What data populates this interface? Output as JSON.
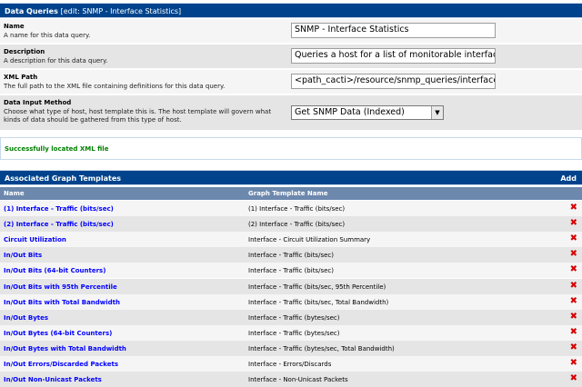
{
  "header": {
    "title": "Data Queries",
    "subtitle": "[edit: SNMP - Interface Statistics]"
  },
  "fields": {
    "name": {
      "label": "Name",
      "description": "A name for this data query.",
      "value": "SNMP - Interface Statistics"
    },
    "description": {
      "label": "Description",
      "description": "A description for this data query.",
      "value": "Queries a host for a list of monitorable interfaces"
    },
    "xml_path": {
      "label": "XML Path",
      "description": "The full path to the XML file containing definitions for this data query.",
      "value": "<path_cacti>/resource/snmp_queries/interface.xml"
    },
    "input_method": {
      "label": "Data Input Method",
      "description": "Choose what type of host, host template this is. The host template will govern what kinds of data should be gathered from this type of host.",
      "value": "Get SNMP Data (Indexed)"
    }
  },
  "status": {
    "message": "Successfully located XML file",
    "color": "#008000"
  },
  "graph_templates": {
    "title": "Associated Graph Templates",
    "add_label": "Add",
    "columns": {
      "name": "Name",
      "template": "Graph Template Name"
    },
    "rows": [
      {
        "name": "(1) Interface - Traffic (bits/sec)",
        "template": "(1) Interface - Traffic (bits/sec)"
      },
      {
        "name": "(2) Interface - Traffic (bits/sec)",
        "template": "(2) Interface - Traffic (bits/sec)"
      },
      {
        "name": "Circuit Utilization",
        "template": "Interface - Circuit Utilization Summary"
      },
      {
        "name": "In/Out Bits",
        "template": "Interface - Traffic (bits/sec)"
      },
      {
        "name": "In/Out Bits (64-bit Counters)",
        "template": "Interface - Traffic (bits/sec)"
      },
      {
        "name": "In/Out Bits with 95th Percentile",
        "template": "Interface - Traffic (bits/sec, 95th Percentile)"
      },
      {
        "name": "In/Out Bits with Total Bandwidth",
        "template": "Interface - Traffic (bits/sec, Total Bandwidth)"
      },
      {
        "name": "In/Out Bytes",
        "template": "Interface - Traffic (bytes/sec)"
      },
      {
        "name": "In/Out Bytes (64-bit Counters)",
        "template": "Interface - Traffic (bytes/sec)"
      },
      {
        "name": "In/Out Bytes with Total Bandwidth",
        "template": "Interface - Traffic (bytes/sec, Total Bandwidth)"
      },
      {
        "name": "In/Out Errors/Discarded Packets",
        "template": "Interface - Errors/Discards"
      },
      {
        "name": "In/Out Non-Unicast Packets",
        "template": "Interface - Non-Unicast Packets"
      }
    ],
    "delete_icon": "delete-x-icon",
    "delete_color": "#d80000"
  },
  "colors": {
    "header_bg": "#00438c",
    "column_header_bg": "#6d88ad",
    "row_light": "#f5f5f5",
    "row_dark": "#e5e5e5",
    "link": "#0000ff"
  }
}
